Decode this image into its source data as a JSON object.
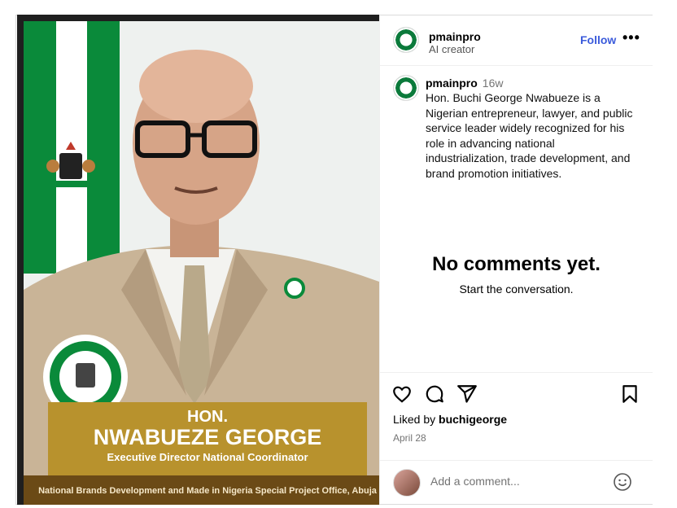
{
  "post": {
    "username": "pmainpro",
    "subtitle": "AI creator",
    "follow_label": "Follow",
    "more_label": "•••",
    "caption_user": "pmainpro",
    "caption_time": "16w",
    "caption": "Hon. Buchi George Nwabueze is a Nigerian entrepreneur, lawyer, and public service leader widely recognized for his role in advancing national industrialization, trade development, and brand promotion initiatives.",
    "empty_title": "No comments yet.",
    "empty_sub": "Start the conversation.",
    "liked_prefix": "Liked by ",
    "liked_user": "buchigeorge",
    "date": "April 28",
    "comment_placeholder": "Add a comment...",
    "icons": [
      "heart-icon",
      "comment-icon",
      "share-icon",
      "bookmark-icon",
      "emoji-icon"
    ]
  },
  "photo": {
    "title_small": "HON.",
    "title_name": "NWABUEZE GEORGE",
    "role": "Executive Director National Coordinator",
    "footer": "National Brands Development and Made in Nigeria Special Project Office, Abuja"
  },
  "colors": {
    "follow": "#3b5bdb",
    "flag_green": "#0a8a3a",
    "banner_gold": "#b8922d",
    "suit": "#c9b497"
  }
}
